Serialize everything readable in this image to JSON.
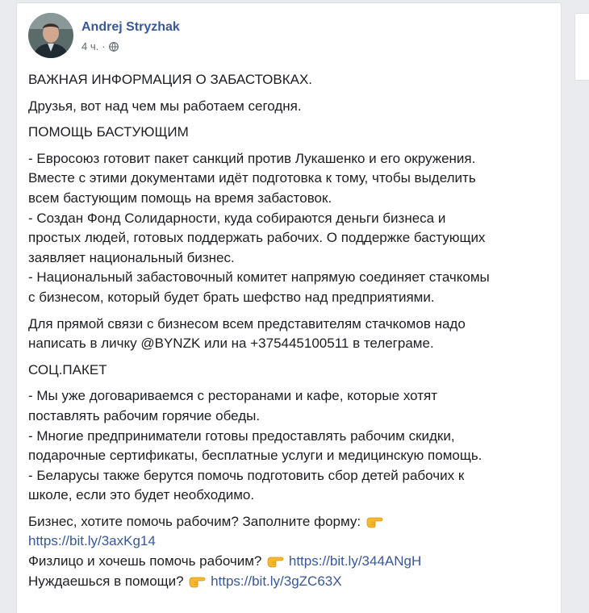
{
  "post": {
    "author": "Andrej Stryzhak",
    "time": "4 ч.",
    "separator": "·",
    "privacy_icon": "globe-icon",
    "accent_color": "#385898",
    "paragraphs": {
      "title": "ВАЖНАЯ ИНФОРМАЦИЯ О ЗАБАСТОВКАХ.",
      "intro": "Друзья, вот над чем мы работаем сегодня.",
      "help_heading": "ПОМОЩЬ БАСТУЮЩИМ",
      "help_lines": [
        "- Евросоюз готовит пакет санкций против Лукашенко и его окружения.",
        "Вместе с этими документами идёт подготовка к тому, чтобы выделить",
        "всем бастующим помощь на время забастовок.",
        "- Создан Фонд Солидарности, куда собираются деньги бизнеса и",
        "простых людей, готовых поддержать рабочих. О поддержке бастующих",
        "заявляет национальный бизнес.",
        "- Национальный забастовочный комитет напрямую соединяет стачкомы",
        "с бизнесом, который будет брать шефство над предприятиями."
      ],
      "contact_lines": [
        "Для прямой связи с бизнесом всем представителям стачкомов надо",
        "написать в личку @BYNZK или на +375445100511 в телеграме."
      ],
      "social_heading": "СОЦ.ПАКЕТ",
      "social_lines": [
        "- Мы уже договариваемся с ресторанами и кафе, которые хотят",
        "поставлять рабочим горячие обеды.",
        "- Многие предприниматели готовы предоставлять рабочим скидки,",
        "подарочные сертификаты, бесплатные услуги и медицинскую помощь.",
        "- Беларусы также берутся помочь подготовить сбор детей рабочих к",
        "школе, если это будет необходимо."
      ],
      "cta_business_text": "Бизнес, хотите помочь рабочим? Заполните форму:",
      "cta_business_link": "https://bit.ly/3axKg14",
      "cta_person_text": "Физлицо и хочешь помочь рабочим?",
      "cta_person_link": "https://bit.ly/344ANgH",
      "cta_need_text": "Нуждаешься в помощи?",
      "cta_need_link": "https://bit.ly/3gZC63X"
    },
    "emoji_icon": "pointing-right-hand-icon"
  }
}
